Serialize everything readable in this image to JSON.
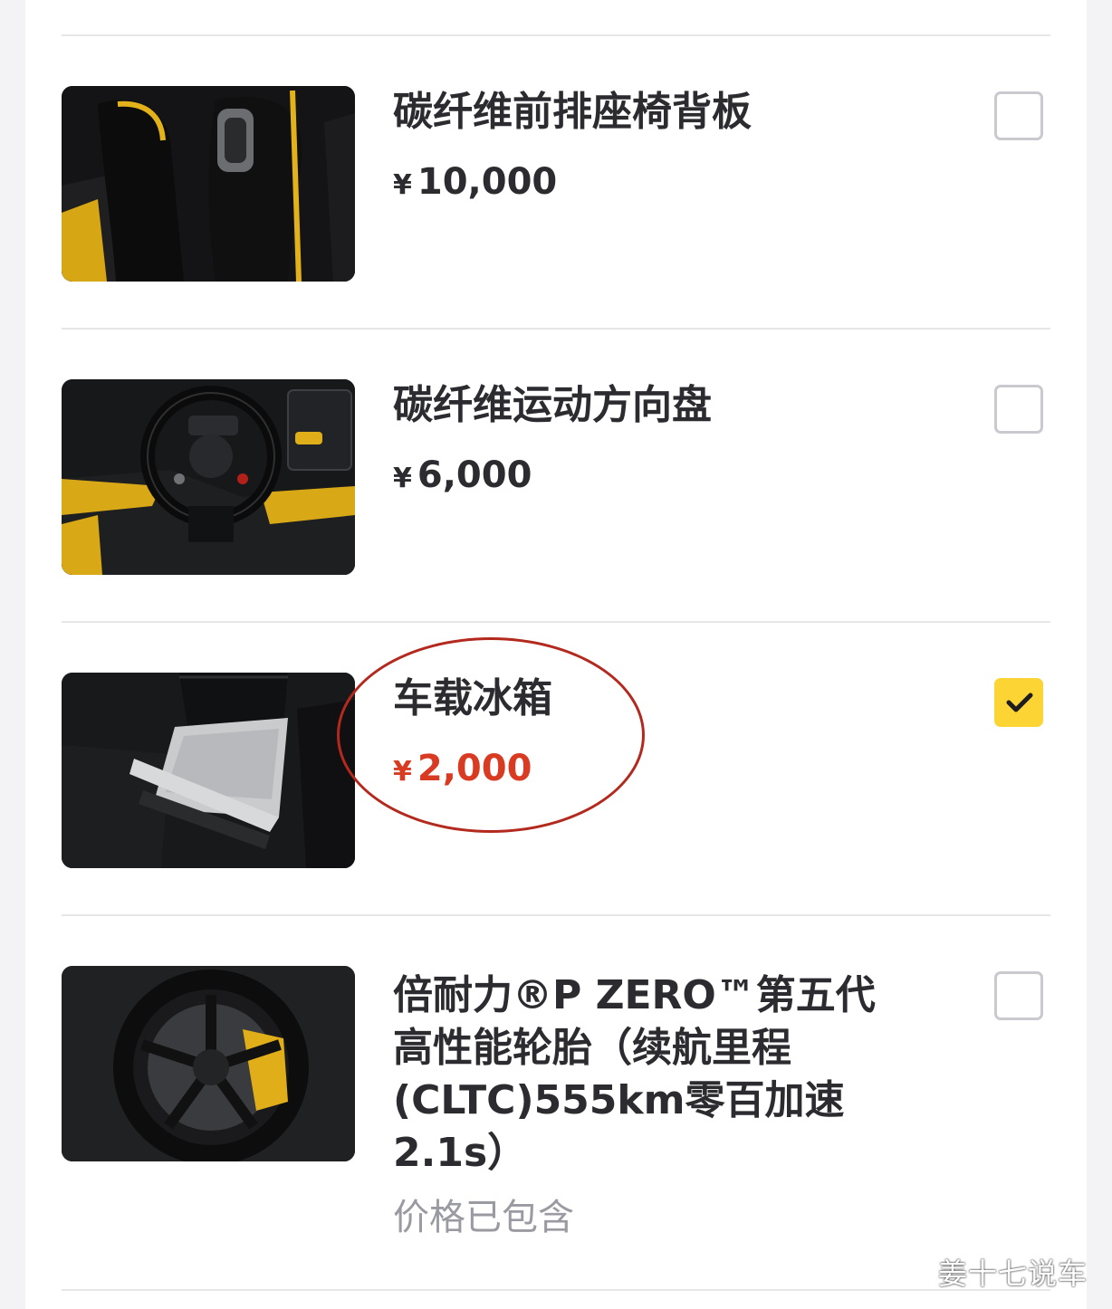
{
  "items": [
    {
      "title": "碳纤维前排座椅背板",
      "currency": "¥",
      "price": "10,000",
      "checked": false,
      "image": "carbon-seat-back-image"
    },
    {
      "title": "碳纤维运动方向盘",
      "currency": "¥",
      "price": "6,000",
      "checked": false,
      "image": "steering-wheel-image"
    },
    {
      "title": "车载冰箱",
      "currency": "¥",
      "price": "2,000",
      "checked": true,
      "image": "car-fridge-image",
      "price_color": "#d93a22"
    },
    {
      "title_lines": [
        "倍耐力®P ZERO™第五代",
        "高性能轮胎（续航里程",
        "(CLTC)555km零百加速",
        "2.1s）"
      ],
      "note": "价格已包含",
      "checked": false,
      "image": "tire-wheel-image"
    }
  ],
  "watermark": "姜十七说车",
  "colors": {
    "accent_yellow": "#fcd434",
    "price_red": "#d93a22",
    "annotation_circle": "#b3291e"
  }
}
